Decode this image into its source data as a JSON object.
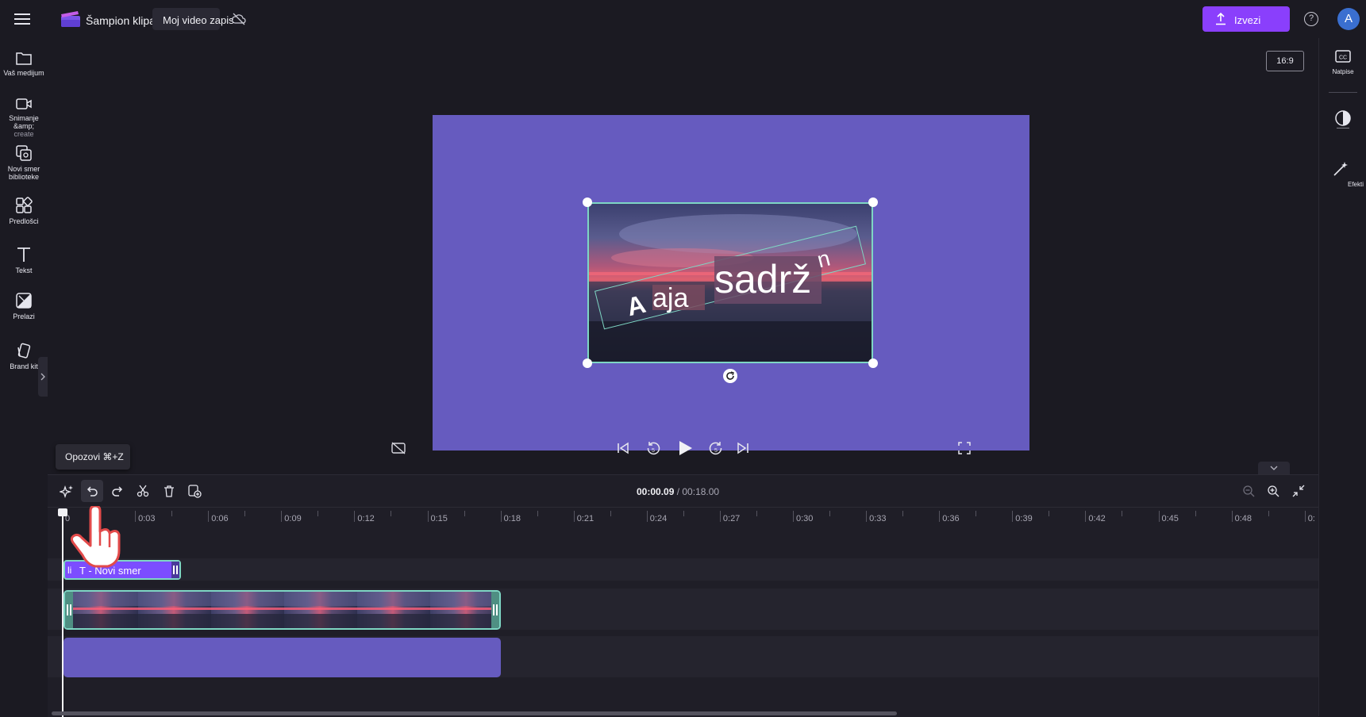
{
  "header": {
    "app_name": "Šampion klipa",
    "project_name": "Moj video zapis",
    "export_label": "Izvezi",
    "avatar_letter": "A"
  },
  "sidebar": {
    "items": [
      {
        "label": "Vaš medijum",
        "sub": ""
      },
      {
        "label": "Snimanje &amp;",
        "sub": "create"
      },
      {
        "label": "Novi smer",
        "sub": "biblioteke"
      },
      {
        "label": "Predlošci",
        "sub": ""
      },
      {
        "label": "Tekst",
        "sub": ""
      },
      {
        "label": "Prelazi",
        "sub": ""
      },
      {
        "label": "Brand kit",
        "sub": ""
      }
    ]
  },
  "rightbar": {
    "captions_label": "Natpise",
    "effects_label": "Efekti"
  },
  "preview": {
    "aspect_ratio": "16:9",
    "overlay_text_big": "sadrž",
    "overlay_text_sup": "n",
    "overlay_text_small": "aja",
    "overlay_text_a": "A"
  },
  "tooltip": {
    "undo": "Opozovi ⌘+Z"
  },
  "timeline": {
    "current_time": "00:00.09",
    "total_time": "/ 00:18.00",
    "ruler": [
      "0",
      "0:03",
      "0:06",
      "0:09",
      "0:12",
      "0:15",
      "0:18",
      "0:21",
      "0:24",
      "0:27",
      "0:30",
      "0:33",
      "0:36",
      "0:39",
      "0:42",
      "0:45",
      "0:48",
      "0:"
    ],
    "text_clip_label": "T - Novi smer",
    "text_clip_marker": "li"
  },
  "colors": {
    "accent": "#8a3ffc",
    "canvas": "#665bbf",
    "selection": "#7ed6c4"
  }
}
